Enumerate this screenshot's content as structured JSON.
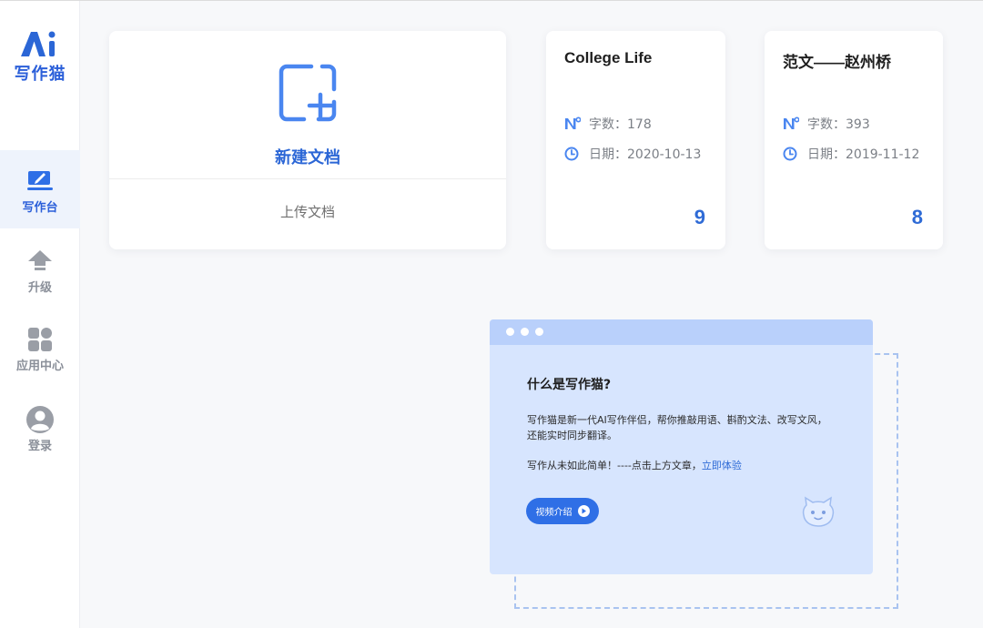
{
  "sidebar": {
    "logo_text": "写作猫",
    "items": [
      {
        "label": "写作台",
        "icon": "edit-icon",
        "active": true
      },
      {
        "label": "升级",
        "icon": "upgrade-arrow-icon",
        "active": false
      },
      {
        "label": "应用中心",
        "icon": "apps-grid-icon",
        "active": false
      },
      {
        "label": "登录",
        "icon": "user-icon",
        "active": false
      }
    ]
  },
  "new_doc": {
    "label": "新建文档",
    "upload_label": "上传文档",
    "icon": "new-document-plus-icon"
  },
  "documents": [
    {
      "title": "College Life",
      "word_count": "字数：178",
      "date": "日期：2020-10-13",
      "count": "9"
    },
    {
      "title": "范文——赵州桥",
      "word_count": "字数：393",
      "date": "日期：2019-11-12",
      "count": "8"
    }
  ],
  "intro": {
    "title": "什么是写作猫?",
    "line1": "写作猫是新一代AI写作伴侣，帮你推敲用语、斟酌文法、改写文风，",
    "line2": "还能实时同步翻译。",
    "line3_prefix": "写作从未如此简单！----点击上方文章，",
    "line3_link": "立即体验",
    "video_button": "视频介绍",
    "mascot_icon": "cat-mascot-icon"
  },
  "colors": {
    "brand": "#2b66d6",
    "panel": "#d7e5fe",
    "panel_header": "#b9d0fb",
    "button": "#2f6fe6"
  }
}
